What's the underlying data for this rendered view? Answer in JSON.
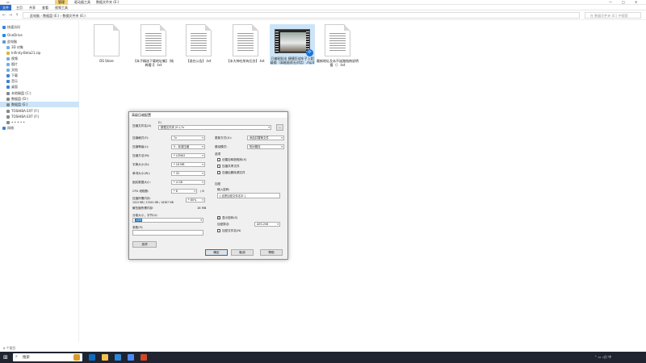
{
  "window": {
    "tabs": [
      "管理",
      "驱动器工具",
      "数据文件夹 (E:)"
    ],
    "ribbon": [
      "文件",
      "主页",
      "共享",
      "查看",
      "视频工具"
    ],
    "minimize": "—",
    "maximize": "□",
    "close": "✕"
  },
  "address": {
    "back": "←",
    "forward": "→",
    "up": "↑",
    "path": "此电脑 › 数据盘 (E:) › 数据文件夹 (E:)",
    "search_placeholder": "在 数据文件夹 (E:) 中搜索"
  },
  "sidebar": {
    "items": [
      {
        "label": "快速访问",
        "color": "#3b82d6"
      },
      {
        "label": "OneDrive",
        "color": "#2a86e0"
      },
      {
        "label": "此电脑",
        "color": "#5a9bd5"
      },
      {
        "label": "3D 对象",
        "color": "#6ab0e6"
      },
      {
        "label": "Infinity-Beta21.zip",
        "color": "#e0b23c"
      },
      {
        "label": "视频",
        "color": "#6ab0e6"
      },
      {
        "label": "图片",
        "color": "#6ab0e6"
      },
      {
        "label": "文档",
        "color": "#6ab0e6"
      },
      {
        "label": "下载",
        "color": "#3b82d6"
      },
      {
        "label": "音乐",
        "color": "#3b82d6"
      },
      {
        "label": "桌面",
        "color": "#3b82d6"
      },
      {
        "label": "本地磁盘 (C:)",
        "color": "#888888"
      },
      {
        "label": "数据盘 (D:)",
        "color": "#888888"
      },
      {
        "label": "数据盘 (E:)",
        "color": "#888888",
        "selected": true
      },
      {
        "label": "TOSHIBA EXT (F:)",
        "color": "#888888"
      },
      {
        "label": "TOSHIBA EXT (F:)",
        "color": "#888888"
      },
      {
        "label": "• • • • •",
        "color": "#888888"
      },
      {
        "label": "网络",
        "color": "#3b82d6"
      }
    ]
  },
  "files": [
    {
      "name": "DS Store",
      "type": "doc"
    },
    {
      "name": "【本子精选下载地址集】（纯粹看）】.txt",
      "type": "txt"
    },
    {
      "name": "【说在公告】.txt",
      "type": "txt"
    },
    {
      "name": "【本大神在所有后台】.txt",
      "type": "txt"
    },
    {
      "name": "已被粘贴出 捷捷狂战车子上超级版（高能画质无对话）.mp4",
      "type": "video"
    },
    {
      "name": "最新地址及永不迷路指南说明看（）.txt",
      "type": "txt"
    }
  ],
  "dialog": {
    "title": "高级压缩配置",
    "archive_label": "压缩文件名(A)",
    "archive_path": "E:\\",
    "archive_name": "数据文件夹 (E:).7z",
    "browse": "...",
    "format_label": "压缩格式(F):",
    "format_value": "7z",
    "level_label": "压缩等级(L):",
    "level_value": "5 - 标准压缩",
    "method_label": "压缩方法(M):",
    "method_value": "* LZMA2",
    "dict_label": "字典大小(D):",
    "dict_value": "* 16 MB",
    "word_label": "单词大小(W):",
    "word_value": "* 32",
    "solid_label": "固实数据大小:",
    "solid_value": "* 4 GB",
    "cpu_label": "CPU 线程数:",
    "cpu_value": "* 8",
    "cpu_total": "/ 8",
    "mem_label": "压缩所需内存:",
    "mem_value": "1024 MB / 13341 MB / 16387 MB",
    "mem_pct": "* 80%",
    "decomp_label": "解压缩所需内存:",
    "decomp_value": "18 MB",
    "split_label": "分卷大小，字节(V):",
    "split_value": "10M",
    "params_label": "参数(P):",
    "options_button": "选项",
    "update_label": "更新方式(U):",
    "update_value": "添加并替换文件",
    "path_label": "路径模式:",
    "path_value": "相对路径",
    "options_group": "选项",
    "opt1": "创建自释放程序(X)",
    "opt2": "压缩共享文件",
    "opt3": "压缩后删除源文件",
    "enc_group": "加密",
    "enc_pwd_label": "输入密码:",
    "enc_pwd_value": "[ 这是加密文件名字 ]",
    "show_pwd": "显示密码(S)",
    "enc_method_label": "加密算法:",
    "enc_method_value": "AES-256",
    "enc_names": "加密文件名(N)",
    "ok": "确定",
    "cancel": "取消",
    "help": "帮助"
  },
  "statusbar": {
    "text": "6 个项目"
  },
  "taskbar": {
    "search": "搜索",
    "clock_time": "",
    "clock_date": "",
    "colors": {
      "bg": "#1f2430"
    }
  }
}
